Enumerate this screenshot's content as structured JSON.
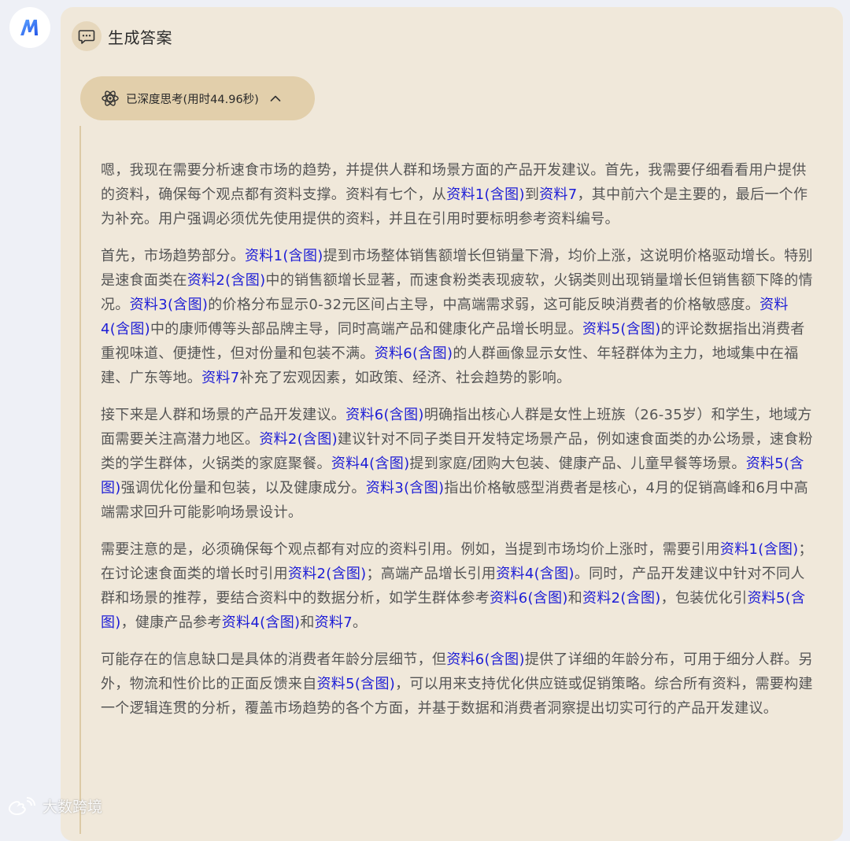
{
  "assistant": {
    "icon": "m-logo-icon"
  },
  "header": {
    "icon": "chat-bubble-icon",
    "title": "生成答案"
  },
  "thinking": {
    "label": "已深度思考(用时44.96秒)",
    "icon": "atom-icon",
    "toggle_icon": "chevron-up-icon"
  },
  "paragraphs": [
    [
      {
        "text": "嗯，我现在需要分析速食市场的趋势，并提供人群和场景方面的产品开发建议。首先，我需要仔细看看用户提供的资料，确保每个观点都有资料支撑。资料有七个，从"
      },
      {
        "ref": "资料1(含图)"
      },
      {
        "text": "到"
      },
      {
        "ref": "资料7"
      },
      {
        "text": "，其中前六个是主要的，最后一个作为补充。用户强调必须优先使用提供的资料，并且在引用时要标明参考资料编号。"
      }
    ],
    [
      {
        "text": "首先，市场趋势部分。"
      },
      {
        "ref": "资料1(含图)"
      },
      {
        "text": "提到市场整体销售额增长但销量下滑，均价上涨，这说明价格驱动增长。特别是速食面类在"
      },
      {
        "ref": "资料2(含图)"
      },
      {
        "text": "中的销售额增长显著，而速食粉类表现疲软，火锅类则出现销量增长但销售额下降的情况。"
      },
      {
        "ref": "资料3(含图)"
      },
      {
        "text": "的价格分布显示0-32元区间占主导，中高端需求弱，这可能反映消费者的价格敏感度。"
      },
      {
        "ref": "资料4(含图)"
      },
      {
        "text": "中的康师傅等头部品牌主导，同时高端产品和健康化产品增长明显。"
      },
      {
        "ref": "资料5(含图)"
      },
      {
        "text": "的评论数据指出消费者重视味道、便捷性，但对份量和包装不满。"
      },
      {
        "ref": "资料6(含图)"
      },
      {
        "text": "的人群画像显示女性、年轻群体为主力，地域集中在福建、广东等地。"
      },
      {
        "ref": "资料7"
      },
      {
        "text": "补充了宏观因素，如政策、经济、社会趋势的影响。"
      }
    ],
    [
      {
        "text": "接下来是人群和场景的产品开发建议。"
      },
      {
        "ref": "资料6(含图)"
      },
      {
        "text": "明确指出核心人群是女性上班族（26-35岁）和学生，地域方面需要关注高潜力地区。"
      },
      {
        "ref": "资料2(含图)"
      },
      {
        "text": "建议针对不同子类目开发特定场景产品，例如速食面类的办公场景，速食粉类的学生群体，火锅类的家庭聚餐。"
      },
      {
        "ref": "资料4(含图)"
      },
      {
        "text": "提到家庭/团购大包装、健康产品、儿童早餐等场景。"
      },
      {
        "ref": "资料5(含图)"
      },
      {
        "text": "强调优化份量和包装，以及健康成分。"
      },
      {
        "ref": "资料3(含图)"
      },
      {
        "text": "指出价格敏感型消费者是核心，4月的促销高峰和6月中高端需求回升可能影响场景设计。"
      }
    ],
    [
      {
        "text": "需要注意的是，必须确保每个观点都有对应的资料引用。例如，当提到市场均价上涨时，需要引用"
      },
      {
        "ref": "资料1(含图)"
      },
      {
        "text": "；在讨论速食面类的增长时引用"
      },
      {
        "ref": "资料2(含图)"
      },
      {
        "text": "；高端产品增长引用"
      },
      {
        "ref": "资料4(含图)"
      },
      {
        "text": "。同时，产品开发建议中针对不同人群和场景的推荐，要结合资料中的数据分析，如学生群体参考"
      },
      {
        "ref": "资料6(含图)"
      },
      {
        "text": "和"
      },
      {
        "ref": "资料2(含图)"
      },
      {
        "text": "，包装优化引"
      },
      {
        "ref": "资料5(含图)"
      },
      {
        "text": "，健康产品参考"
      },
      {
        "ref": "资料4(含图)"
      },
      {
        "text": "和"
      },
      {
        "ref": "资料7"
      },
      {
        "text": "。"
      }
    ],
    [
      {
        "text": "可能存在的信息缺口是具体的消费者年龄分层细节，但"
      },
      {
        "ref": "资料6(含图)"
      },
      {
        "text": "提供了详细的年龄分布，可用于细分人群。另外，物流和性价比的正面反馈来自"
      },
      {
        "ref": "资料5(含图)"
      },
      {
        "text": "，可以用来支持优化供应链或促销策略。综合所有资料，需要构建一个逻辑连贯的分析，覆盖市场趋势的各个方面，并基于数据和消费者洞察提出切实可行的产品开发建议。"
      }
    ]
  ],
  "watermark": {
    "icon": "weibo-logo-icon",
    "text": "大数跨境"
  },
  "colors": {
    "card_bg": "#f0e8da",
    "pill_bg": "#e2cfab",
    "link": "#1d1dd6",
    "body_text": "#555555"
  }
}
